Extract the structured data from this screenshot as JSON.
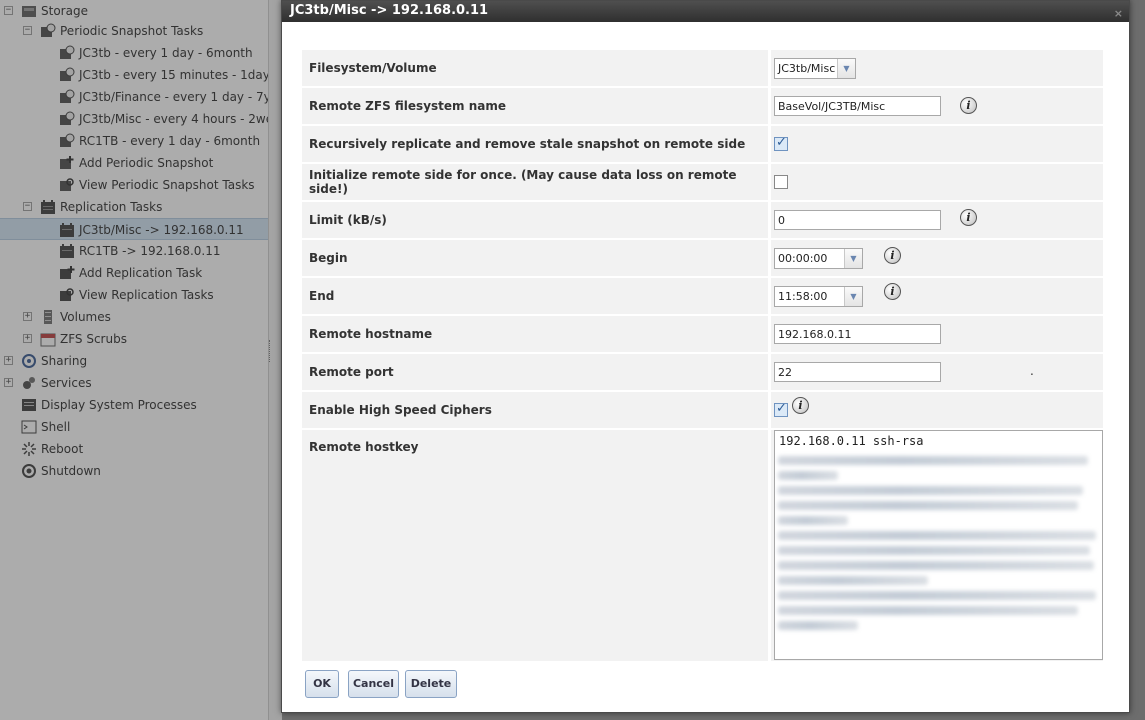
{
  "tree": {
    "items": [
      {
        "label": "Storage",
        "icon": "storage-icon"
      },
      {
        "label": "Periodic Snapshot Tasks",
        "icon": "snapshot-tasks-icon"
      },
      {
        "label": "JC3tb - every 1 day - 6month",
        "icon": "snapshot-icon"
      },
      {
        "label": "JC3tb - every 15 minutes - 1day",
        "icon": "snapshot-icon"
      },
      {
        "label": "JC3tb/Finance - every 1 day - 7y",
        "icon": "snapshot-icon"
      },
      {
        "label": "JC3tb/Misc - every 4 hours - 2we",
        "icon": "snapshot-icon"
      },
      {
        "label": "RC1TB - every 1 day - 6month",
        "icon": "snapshot-icon"
      },
      {
        "label": "Add Periodic Snapshot",
        "icon": "add-snapshot-icon"
      },
      {
        "label": "View Periodic Snapshot Tasks",
        "icon": "view-snapshot-icon"
      },
      {
        "label": "Replication Tasks",
        "icon": "replication-icon"
      },
      {
        "label": "JC3tb/Misc -> 192.168.0.11",
        "icon": "replication-task-icon"
      },
      {
        "label": "RC1TB -> 192.168.0.11",
        "icon": "replication-task-icon"
      },
      {
        "label": "Add Replication Task",
        "icon": "add-replication-icon"
      },
      {
        "label": "View Replication Tasks",
        "icon": "view-replication-icon"
      },
      {
        "label": "Volumes",
        "icon": "volumes-icon"
      },
      {
        "label": "ZFS Scrubs",
        "icon": "calendar-icon"
      },
      {
        "label": "Sharing",
        "icon": "sharing-icon"
      },
      {
        "label": "Services",
        "icon": "services-icon"
      },
      {
        "label": "Display System Processes",
        "icon": "processes-icon"
      },
      {
        "label": "Shell",
        "icon": "shell-icon"
      },
      {
        "label": "Reboot",
        "icon": "reboot-icon"
      },
      {
        "label": "Shutdown",
        "icon": "shutdown-icon"
      }
    ]
  },
  "dialog": {
    "title": "JC3tb/Misc -> 192.168.0.11",
    "close_glyph": "×",
    "fields": {
      "filesystem": {
        "label": "Filesystem/Volume",
        "value": "JC3tb/Misc"
      },
      "remote_fs": {
        "label": "Remote ZFS filesystem name",
        "value": "BaseVol/JC3TB/Misc"
      },
      "recursive": {
        "label": "Recursively replicate and remove stale snapshot on remote side",
        "checked": true
      },
      "initialize": {
        "label": "Initialize remote side for once. (May cause data loss on remote side!)",
        "checked": false
      },
      "limit": {
        "label": "Limit (kB/s)",
        "value": "0"
      },
      "begin": {
        "label": "Begin",
        "value": "00:00:00"
      },
      "end": {
        "label": "End",
        "value": "11:58:00"
      },
      "hostname": {
        "label": "Remote hostname",
        "value": "192.168.0.11"
      },
      "port": {
        "label": "Remote port",
        "value": "22"
      },
      "ciphers": {
        "label": "Enable High Speed Ciphers",
        "checked": true
      },
      "hostkey": {
        "label": "Remote hostkey",
        "value": "192.168.0.11 ssh-rsa"
      }
    },
    "info_glyph": "i",
    "checkmark_glyph": "✓",
    "select_arrow_glyph": "▼",
    "stray_dot": ".",
    "buttons": {
      "ok": "OK",
      "cancel": "Cancel",
      "delete": "Delete"
    }
  },
  "colors": {
    "titlebar": "#3a3a3a",
    "row_bg": "#f2f2f2",
    "button_border": "#8aa3c4",
    "selected_row": "#cfe3f5"
  }
}
